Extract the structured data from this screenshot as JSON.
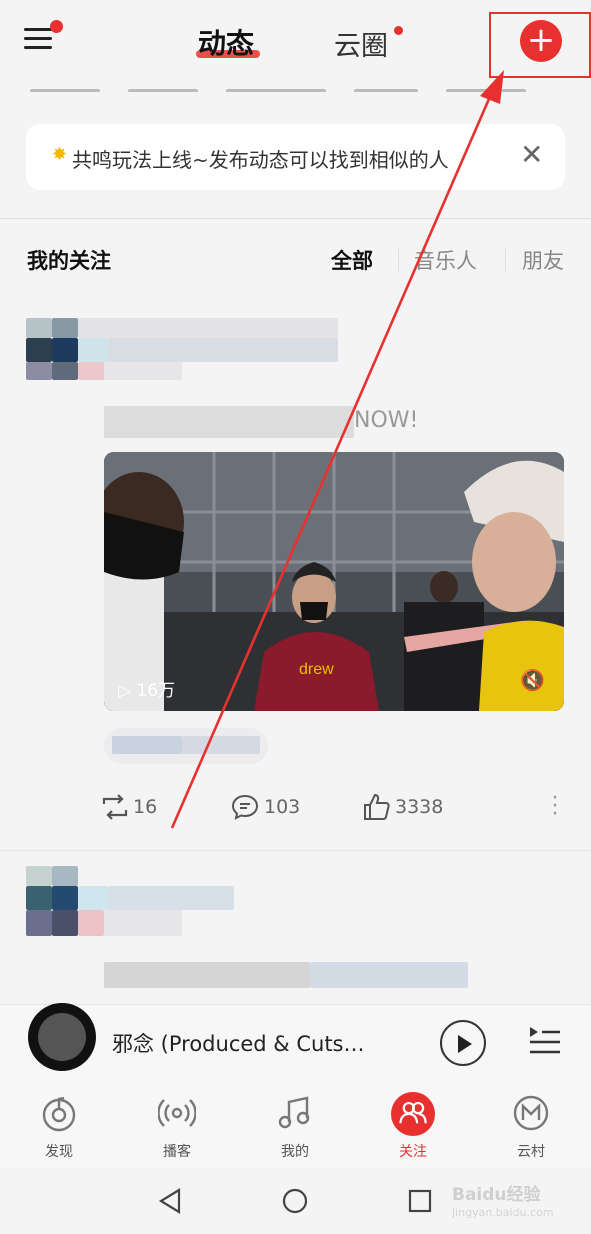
{
  "header": {
    "tabs": [
      {
        "label": "动态",
        "active": true
      },
      {
        "label": "云圈",
        "active": false,
        "has_dot": true
      }
    ],
    "add_button_glyph": "+"
  },
  "notice": {
    "icon": "sparkle-icon",
    "text": "共鸣玩法上线~发布动态可以找到相似的人",
    "close_glyph": "✕"
  },
  "follow": {
    "title": "我的关注",
    "filters": [
      "全部",
      "音乐人",
      "朋友"
    ],
    "active_filter": "全部"
  },
  "post": {
    "caption_visible_fragment": "NOW!",
    "video_play_count": "16万",
    "actions": {
      "repost_count": "16",
      "comment_count": "103",
      "like_count": "3338"
    }
  },
  "player": {
    "song_title": "邪念 (Produced & Cuts…"
  },
  "bottom_nav": [
    {
      "label": "发现",
      "icon": "discover-icon",
      "active": false
    },
    {
      "label": "播客",
      "icon": "podcast-icon",
      "active": false
    },
    {
      "label": "我的",
      "icon": "music-note-icon",
      "active": false
    },
    {
      "label": "关注",
      "icon": "follow-icon",
      "active": true
    },
    {
      "label": "云村",
      "icon": "cloud-village-icon",
      "active": false
    }
  ],
  "watermark": {
    "brand": "Baidu经验",
    "url": "jingyan.baidu.com"
  },
  "colors": {
    "accent": "#e8312f",
    "background": "#f4f4f4",
    "card": "#ffffff"
  }
}
